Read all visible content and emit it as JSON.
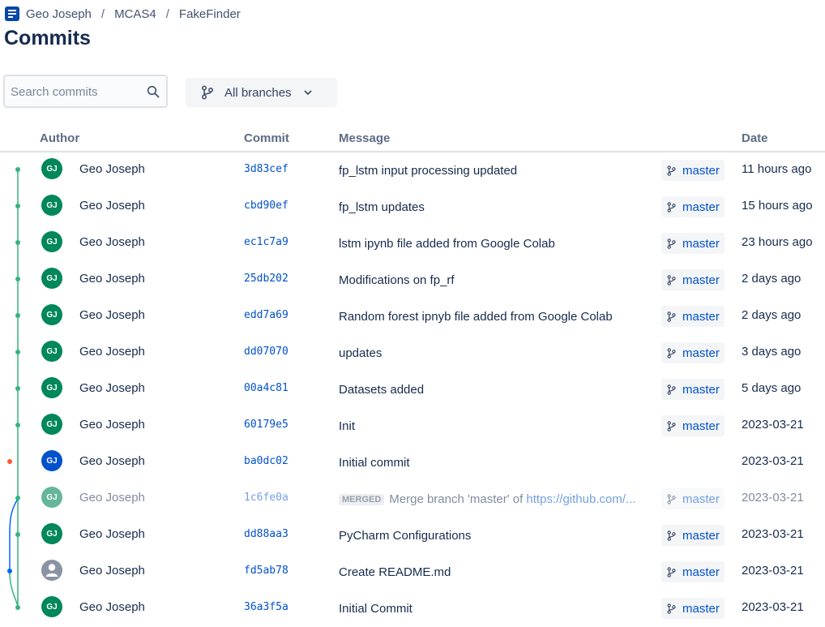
{
  "breadcrumb": {
    "items": [
      "Geo Joseph",
      "MCAS4",
      "FakeFinder"
    ]
  },
  "page_title": "Commits",
  "search": {
    "placeholder": "Search commits"
  },
  "branch_filter": {
    "label": "All branches"
  },
  "table": {
    "columns": [
      "Author",
      "Commit",
      "Message",
      "Date"
    ]
  },
  "colors": {
    "graph_main": "#36b37e",
    "graph_branch": "#0065ff",
    "graph_orphan": "#ff5630",
    "link": "#0052cc"
  },
  "commits": [
    {
      "initials": "GJ",
      "author": "Geo Joseph",
      "hash": "3d83cef",
      "message": "fp_lstm input processing updated",
      "branch": "master",
      "date": "11 hours ago",
      "avatar_color": "#00875a"
    },
    {
      "initials": "GJ",
      "author": "Geo Joseph",
      "hash": "cbd90ef",
      "message": "fp_lstm updates",
      "branch": "master",
      "date": "15 hours ago",
      "avatar_color": "#00875a"
    },
    {
      "initials": "GJ",
      "author": "Geo Joseph",
      "hash": "ec1c7a9",
      "message": "lstm ipynb file added from Google Colab",
      "branch": "master",
      "date": "23 hours ago",
      "avatar_color": "#00875a"
    },
    {
      "initials": "GJ",
      "author": "Geo Joseph",
      "hash": "25db202",
      "message": "Modifications on fp_rf",
      "branch": "master",
      "date": "2 days ago",
      "avatar_color": "#00875a"
    },
    {
      "initials": "GJ",
      "author": "Geo Joseph",
      "hash": "edd7a69",
      "message": "Random forest ipnyb file added from Google Colab",
      "branch": "master",
      "date": "2 days ago",
      "avatar_color": "#00875a"
    },
    {
      "initials": "GJ",
      "author": "Geo Joseph",
      "hash": "dd07070",
      "message": "updates",
      "branch": "master",
      "date": "3 days ago",
      "avatar_color": "#00875a"
    },
    {
      "initials": "GJ",
      "author": "Geo Joseph",
      "hash": "00a4c81",
      "message": "Datasets added",
      "branch": "master",
      "date": "5 days ago",
      "avatar_color": "#00875a"
    },
    {
      "initials": "GJ",
      "author": "Geo Joseph",
      "hash": "60179e5",
      "message": "Init",
      "branch": "master",
      "date": "2023-03-21",
      "avatar_color": "#00875a"
    },
    {
      "initials": "GJ",
      "author": "Geo Joseph",
      "hash": "ba0dc02",
      "message": "Initial commit",
      "branch": "",
      "date": "2023-03-21",
      "avatar_color": "#0052cc"
    },
    {
      "initials": "GJ",
      "author": "Geo Joseph",
      "hash": "1c6fe0a",
      "merged_label": "MERGED",
      "message": "Merge branch 'master' of ",
      "message_link": "https://github.com/...",
      "branch": "master",
      "date": "2023-03-21",
      "avatar_color": "#00875a",
      "muted": true
    },
    {
      "initials": "GJ",
      "author": "Geo Joseph",
      "hash": "dd88aa3",
      "message": "PyCharm Configurations",
      "branch": "master",
      "date": "2023-03-21",
      "avatar_color": "#00875a"
    },
    {
      "initials": "",
      "author": "Geo Joseph",
      "hash": "fd5ab78",
      "message": "Create README.md",
      "branch": "master",
      "date": "2023-03-21",
      "avatar_color": "#8993a4",
      "default_avatar": true
    },
    {
      "initials": "GJ",
      "author": "Geo Joseph",
      "hash": "36a3f5a",
      "message": "Initial Commit",
      "branch": "master",
      "date": "2023-03-21",
      "avatar_color": "#00875a"
    }
  ]
}
